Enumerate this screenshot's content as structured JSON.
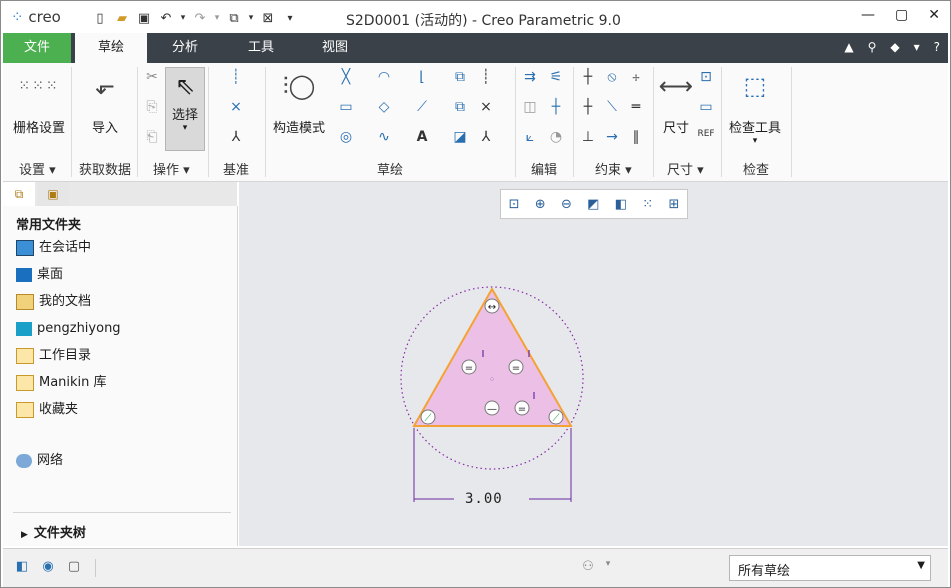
{
  "window": {
    "logo": "creo",
    "title": "S2D0001 (活动的) - Creo Parametric 9.0"
  },
  "tabs": [
    "文件",
    "草绘",
    "分析",
    "工具",
    "视图"
  ],
  "ribbon": {
    "grid_label": "栅格设置",
    "import_label": "导入",
    "select_label": "选择",
    "construction_label": "构造模式",
    "inspect_tool_label": "检查工具",
    "dimension_label": "尺寸",
    "groups": {
      "settings": "设置",
      "get_data": "获取数据",
      "operations": "操作",
      "datum": "基准",
      "sketch": "草绘",
      "edit": "编辑",
      "constrain": "约束",
      "dimension": "尺寸",
      "inspect": "检查"
    }
  },
  "leftpane": {
    "heading": "常用文件夹",
    "items": [
      "在会话中",
      "桌面",
      "我的文档",
      "pengzhiyong",
      "工作目录",
      "Manikin 库",
      "收藏夹"
    ],
    "network": "网络",
    "folder_tree": "文件夹树"
  },
  "canvas": {
    "dimension_value": "3.00",
    "fill_color": "#ecc0e6",
    "edge_color": "#f4a234",
    "circle_color": "#8a2aa8"
  },
  "statusbar": {
    "filter": "所有草绘"
  }
}
